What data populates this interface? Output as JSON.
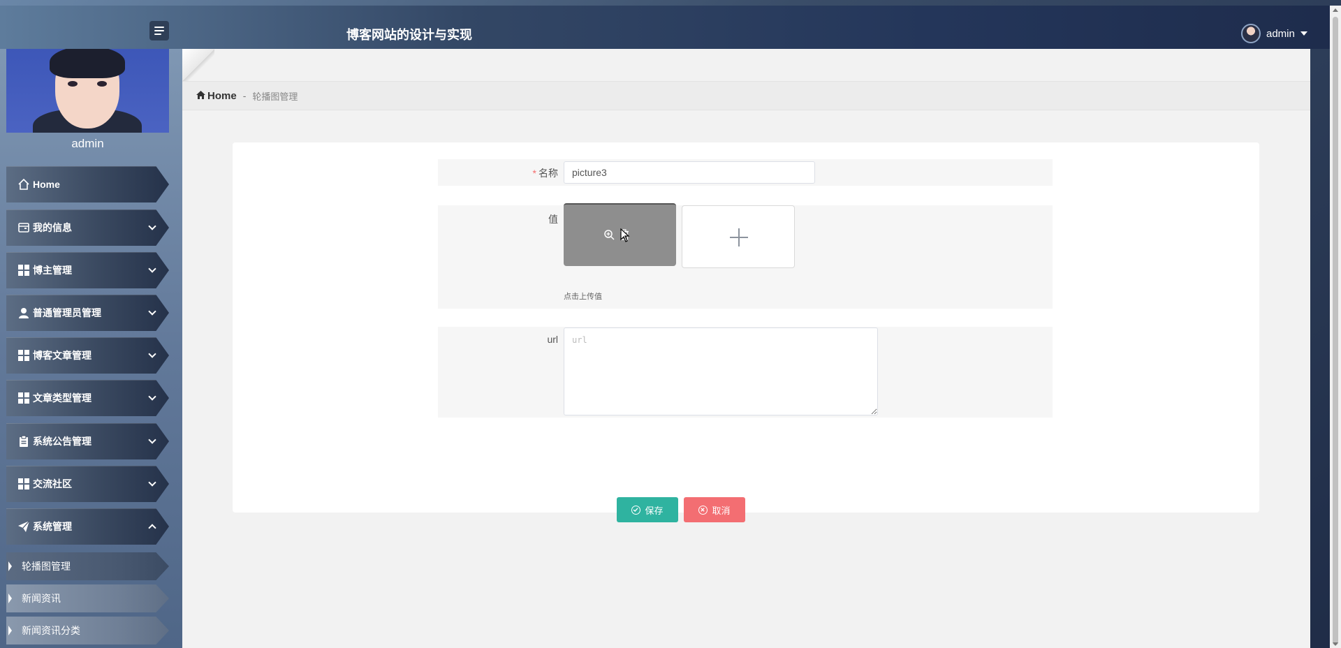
{
  "header": {
    "title": "博客网站的设计与实现",
    "user": "admin"
  },
  "sidebar": {
    "username": "admin",
    "items": [
      {
        "label": "Home",
        "icon": "home-icon"
      },
      {
        "label": "我的信息",
        "icon": "wallet-icon"
      },
      {
        "label": "博主管理",
        "icon": "grid-icon"
      },
      {
        "label": "普通管理员管理",
        "icon": "user-icon"
      },
      {
        "label": "博客文章管理",
        "icon": "grid-icon"
      },
      {
        "label": "文章类型管理",
        "icon": "grid-icon"
      },
      {
        "label": "系统公告管理",
        "icon": "clipboard-icon"
      },
      {
        "label": "交流社区",
        "icon": "grid-icon"
      },
      {
        "label": "系统管理",
        "icon": "paper-plane-icon"
      }
    ],
    "subitems": [
      {
        "label": "轮播图管理"
      },
      {
        "label": "新闻资讯"
      },
      {
        "label": "新闻资讯分类"
      }
    ]
  },
  "breadcrumb": {
    "home": "Home",
    "separator": "-",
    "current": "轮播图管理"
  },
  "form": {
    "name_label": "名称",
    "name_value": "picture3",
    "value_label": "值",
    "upload_hint": "点击上传值",
    "url_label": "url",
    "url_placeholder": "url",
    "save_label": "保存",
    "cancel_label": "取消"
  },
  "colors": {
    "save": "#2fb3a0",
    "cancel": "#f36e72",
    "required": "#f56c6c"
  }
}
